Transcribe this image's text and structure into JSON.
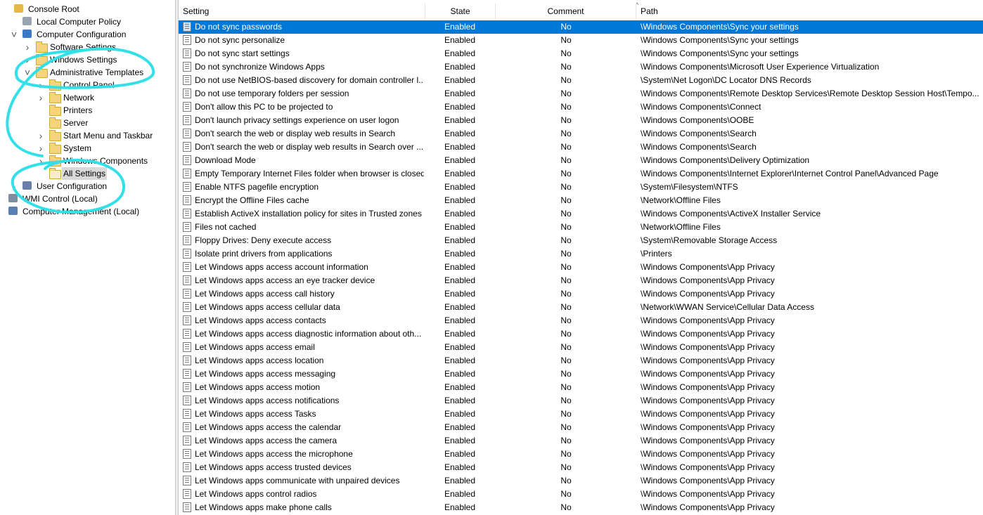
{
  "tree": {
    "items": [
      {
        "label": "Console Root",
        "icon": "console-root-icon",
        "expander": ""
      },
      {
        "label": "Local Computer Policy",
        "icon": "policy-icon",
        "expander": ""
      },
      {
        "label": "Computer Configuration",
        "icon": "computer-icon",
        "expander": "expanded"
      },
      {
        "label": "Software Settings",
        "icon": "folder-icon",
        "expander": "collapsed"
      },
      {
        "label": "Windows Settings",
        "icon": "folder-icon",
        "expander": "collapsed"
      },
      {
        "label": "Administrative Templates",
        "icon": "folder-icon",
        "expander": "expanded"
      },
      {
        "label": "Control Panel",
        "icon": "folder-icon",
        "expander": "collapsed"
      },
      {
        "label": "Network",
        "icon": "folder-icon",
        "expander": "collapsed"
      },
      {
        "label": "Printers",
        "icon": "folder-icon",
        "expander": ""
      },
      {
        "label": "Server",
        "icon": "folder-icon",
        "expander": ""
      },
      {
        "label": "Start Menu and Taskbar",
        "icon": "folder-icon",
        "expander": "collapsed"
      },
      {
        "label": "System",
        "icon": "folder-icon",
        "expander": "collapsed"
      },
      {
        "label": "Windows Components",
        "icon": "folder-icon",
        "expander": "collapsed"
      },
      {
        "label": "All Settings",
        "icon": "all-settings-icon",
        "expander": "",
        "selected": true
      },
      {
        "label": "User Configuration",
        "icon": "user-icon",
        "expander": "collapsed"
      },
      {
        "label": "WMI Control (Local)",
        "icon": "wmi-icon",
        "expander": ""
      },
      {
        "label": "Computer Management (Local)",
        "icon": "computer-management-icon",
        "expander": ""
      }
    ]
  },
  "list": {
    "columns": {
      "setting": "Setting",
      "state": "State",
      "comment": "Comment",
      "path": "Path"
    },
    "sorted_column": "state",
    "rows": [
      {
        "name": "Do not sync passwords",
        "state": "Enabled",
        "comment": "No",
        "path": "\\Windows Components\\Sync your settings",
        "selected": true
      },
      {
        "name": "Do not sync personalize",
        "state": "Enabled",
        "comment": "No",
        "path": "\\Windows Components\\Sync your settings"
      },
      {
        "name": "Do not sync start settings",
        "state": "Enabled",
        "comment": "No",
        "path": "\\Windows Components\\Sync your settings"
      },
      {
        "name": "Do not synchronize Windows Apps",
        "state": "Enabled",
        "comment": "No",
        "path": "\\Windows Components\\Microsoft User Experience Virtualization"
      },
      {
        "name": "Do not use NetBIOS-based discovery for domain controller l...",
        "state": "Enabled",
        "comment": "No",
        "path": "\\System\\Net Logon\\DC Locator DNS Records"
      },
      {
        "name": "Do not use temporary folders per session",
        "state": "Enabled",
        "comment": "No",
        "path": "\\Windows Components\\Remote Desktop Services\\Remote Desktop Session Host\\Tempo..."
      },
      {
        "name": "Don't allow this PC to be projected to",
        "state": "Enabled",
        "comment": "No",
        "path": "\\Windows Components\\Connect"
      },
      {
        "name": "Don't launch privacy settings experience on user logon",
        "state": "Enabled",
        "comment": "No",
        "path": "\\Windows Components\\OOBE"
      },
      {
        "name": "Don't search the web or display web results in Search",
        "state": "Enabled",
        "comment": "No",
        "path": "\\Windows Components\\Search"
      },
      {
        "name": "Don't search the web or display web results in Search over ...",
        "state": "Enabled",
        "comment": "No",
        "path": "\\Windows Components\\Search"
      },
      {
        "name": "Download Mode",
        "state": "Enabled",
        "comment": "No",
        "path": "\\Windows Components\\Delivery Optimization"
      },
      {
        "name": "Empty Temporary Internet Files folder when browser is closed",
        "state": "Enabled",
        "comment": "No",
        "path": "\\Windows Components\\Internet Explorer\\Internet Control Panel\\Advanced Page"
      },
      {
        "name": "Enable NTFS pagefile encryption",
        "state": "Enabled",
        "comment": "No",
        "path": "\\System\\Filesystem\\NTFS"
      },
      {
        "name": "Encrypt the Offline Files cache",
        "state": "Enabled",
        "comment": "No",
        "path": "\\Network\\Offline Files"
      },
      {
        "name": "Establish ActiveX installation policy for sites in Trusted zones",
        "state": "Enabled",
        "comment": "No",
        "path": "\\Windows Components\\ActiveX Installer Service"
      },
      {
        "name": "Files not cached",
        "state": "Enabled",
        "comment": "No",
        "path": "\\Network\\Offline Files"
      },
      {
        "name": "Floppy Drives: Deny execute access",
        "state": "Enabled",
        "comment": "No",
        "path": "\\System\\Removable Storage Access"
      },
      {
        "name": "Isolate print drivers from applications",
        "state": "Enabled",
        "comment": "No",
        "path": "\\Printers"
      },
      {
        "name": "Let Windows apps access account information",
        "state": "Enabled",
        "comment": "No",
        "path": "\\Windows Components\\App Privacy"
      },
      {
        "name": "Let Windows apps access an eye tracker device",
        "state": "Enabled",
        "comment": "No",
        "path": "\\Windows Components\\App Privacy"
      },
      {
        "name": "Let Windows apps access call history",
        "state": "Enabled",
        "comment": "No",
        "path": "\\Windows Components\\App Privacy"
      },
      {
        "name": "Let Windows apps access cellular data",
        "state": "Enabled",
        "comment": "No",
        "path": "\\Network\\WWAN Service\\Cellular Data Access"
      },
      {
        "name": "Let Windows apps access contacts",
        "state": "Enabled",
        "comment": "No",
        "path": "\\Windows Components\\App Privacy"
      },
      {
        "name": "Let Windows apps access diagnostic information about oth...",
        "state": "Enabled",
        "comment": "No",
        "path": "\\Windows Components\\App Privacy"
      },
      {
        "name": "Let Windows apps access email",
        "state": "Enabled",
        "comment": "No",
        "path": "\\Windows Components\\App Privacy"
      },
      {
        "name": "Let Windows apps access location",
        "state": "Enabled",
        "comment": "No",
        "path": "\\Windows Components\\App Privacy"
      },
      {
        "name": "Let Windows apps access messaging",
        "state": "Enabled",
        "comment": "No",
        "path": "\\Windows Components\\App Privacy"
      },
      {
        "name": "Let Windows apps access motion",
        "state": "Enabled",
        "comment": "No",
        "path": "\\Windows Components\\App Privacy"
      },
      {
        "name": "Let Windows apps access notifications",
        "state": "Enabled",
        "comment": "No",
        "path": "\\Windows Components\\App Privacy"
      },
      {
        "name": "Let Windows apps access Tasks",
        "state": "Enabled",
        "comment": "No",
        "path": "\\Windows Components\\App Privacy"
      },
      {
        "name": "Let Windows apps access the calendar",
        "state": "Enabled",
        "comment": "No",
        "path": "\\Windows Components\\App Privacy"
      },
      {
        "name": "Let Windows apps access the camera",
        "state": "Enabled",
        "comment": "No",
        "path": "\\Windows Components\\App Privacy"
      },
      {
        "name": "Let Windows apps access the microphone",
        "state": "Enabled",
        "comment": "No",
        "path": "\\Windows Components\\App Privacy"
      },
      {
        "name": "Let Windows apps access trusted devices",
        "state": "Enabled",
        "comment": "No",
        "path": "\\Windows Components\\App Privacy"
      },
      {
        "name": "Let Windows apps communicate with unpaired devices",
        "state": "Enabled",
        "comment": "No",
        "path": "\\Windows Components\\App Privacy"
      },
      {
        "name": "Let Windows apps control radios",
        "state": "Enabled",
        "comment": "No",
        "path": "\\Windows Components\\App Privacy"
      },
      {
        "name": "Let Windows apps make phone calls",
        "state": "Enabled",
        "comment": "No",
        "path": "\\Windows Components\\App Privacy"
      }
    ]
  },
  "colors": {
    "selection": "#0078d7",
    "annotation": "#33e0e8",
    "folder": "#f5d47a"
  }
}
